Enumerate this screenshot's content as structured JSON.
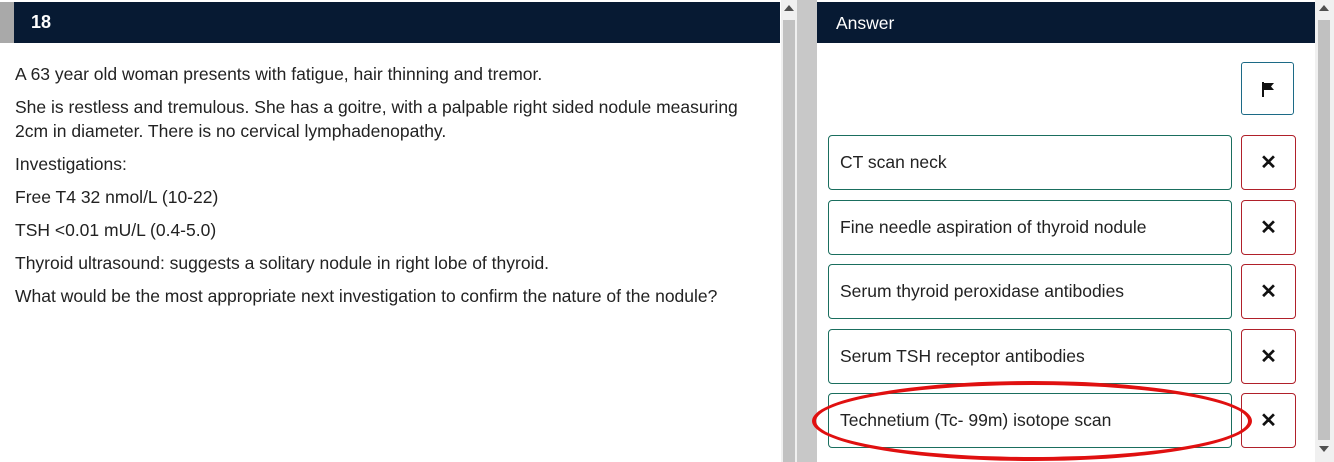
{
  "question": {
    "number": "18",
    "paragraphs": [
      "A 63 year old woman presents with fatigue, hair thinning and tremor.",
      "She is restless and tremulous.  She has a goitre, with a palpable right sided nodule measuring 2cm in diameter. There is no cervical lymphadenopathy.",
      "Investigations:",
      "Free T4 32 nmol/L (10-22)",
      "TSH <0.01 mU/L (0.4-5.0)",
      "Thyroid ultrasound: suggests a solitary nodule in right lobe of thyroid.",
      "What would be the most appropriate next investigation to confirm the nature of the nodule?"
    ]
  },
  "answer_panel": {
    "title": "Answer",
    "flag_icon": "flag-icon",
    "options": [
      {
        "label": "CT scan neck",
        "remove_icon": "close-icon",
        "remove_glyph": "✕"
      },
      {
        "label": "Fine needle aspiration of thyroid nodule",
        "remove_icon": "close-icon",
        "remove_glyph": "✕"
      },
      {
        "label": "Serum thyroid peroxidase antibodies",
        "remove_icon": "close-icon",
        "remove_glyph": "✕"
      },
      {
        "label": "Serum TSH receptor antibodies",
        "remove_icon": "close-icon",
        "remove_glyph": "✕"
      },
      {
        "label": "Technetium (Tc- 99m) isotope scan",
        "remove_icon": "close-icon",
        "remove_glyph": "✕"
      }
    ]
  },
  "colors": {
    "header_bg": "#071a33",
    "option_border": "#1a6e5e",
    "remove_border": "#b0202a",
    "annotation": "#e01010"
  }
}
